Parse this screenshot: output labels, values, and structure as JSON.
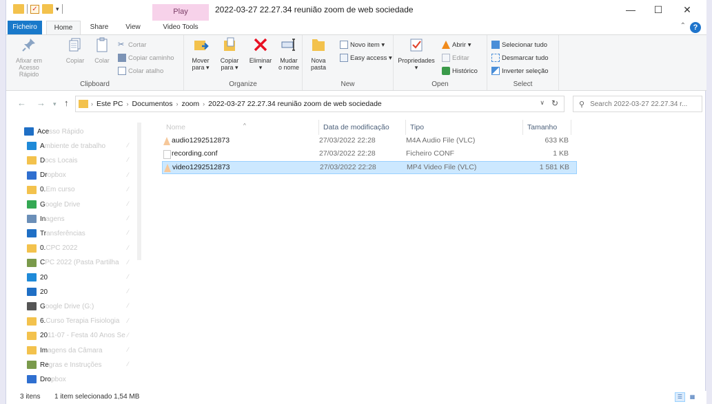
{
  "title_bar": {
    "contextual_tab": "Play",
    "window_title": "2022-03-27 22.27.34 reunião zoom de web sociedade",
    "minimize": "—",
    "maximize": "☐",
    "close": "✕"
  },
  "tabs": [
    "Ficheiro",
    "Home",
    "Share",
    "View",
    "Video Tools"
  ],
  "ribbon": {
    "clipboard": {
      "label": "Clipboard",
      "pin_label": "Afixar em\nAcesso Rápido",
      "copy_label": "Copiar",
      "paste_label": "Colar",
      "cut_label": "Cortar",
      "copy_path_label": "Copiar caminho",
      "paste_shortcut_label": "Colar atalho"
    },
    "organize": {
      "label": "Organize",
      "move_label": "Mover\npara ▾",
      "copy_to_label": "Copiar\npara ▾",
      "delete_label": "Eliminar\n▾",
      "rename_label": "Mudar\no nome"
    },
    "new": {
      "label": "New",
      "new_folder_label": "Nova\npasta",
      "new_item_label": "Novo item ▾",
      "easy_access_label": "Easy access ▾"
    },
    "open": {
      "label": "Open",
      "properties_label": "Propriedades\n▾",
      "open_label": "Abrir ▾",
      "edit_label": "Editar",
      "history_label": "Histórico"
    },
    "select": {
      "label": "Select",
      "select_all_label": "Selecionar tudo",
      "select_none_label": "Desmarcar tudo",
      "invert_label": "Inverter seleção"
    }
  },
  "address": {
    "crumbs": [
      "Este PC",
      "Documentos",
      "zoom",
      "2022-03-27 22.27.34 reunião zoom de web sociedade"
    ],
    "search_placeholder": "Search 2022-03-27 22.27.34 r..."
  },
  "nav_pane": {
    "items": [
      {
        "label": "Ace",
        "faded": "sso Rápido",
        "icon": "star-icon",
        "color": "#1f6fc5"
      },
      {
        "label": "A",
        "faded": "mbiente de trabalho",
        "icon": "desktop-icon",
        "color": "#1f8ad8"
      },
      {
        "label": "D",
        "faded": "ocs Locais",
        "icon": "folder-icon",
        "color": "#f3c24d"
      },
      {
        "label": "Dr",
        "faded": "opbox",
        "icon": "dropbox-icon",
        "color": "#2f6fd0"
      },
      {
        "label": "0.",
        "faded": " Em curso",
        "icon": "folder-icon",
        "color": "#f3c24d"
      },
      {
        "label": "G",
        "faded": "oogle Drive",
        "icon": "google-drive-icon",
        "color": "#34a853"
      },
      {
        "label": "In",
        "faded": "agens",
        "icon": "pictures-icon",
        "color": "#6b8fb8"
      },
      {
        "label": "Tr",
        "faded": "ansferências",
        "icon": "download-icon",
        "color": "#1f6fc5"
      },
      {
        "label": "0.",
        "faded": " CPC 2022",
        "icon": "folder-icon",
        "color": "#f3c24d"
      },
      {
        "label": "C",
        "faded": "PC 2022 (Pasta Partilha",
        "icon": "shared-folder-icon",
        "color": "#7a9a4b"
      },
      {
        "label": "20",
        "faded": "",
        "icon": "globe-icon",
        "color": "#1f8ad8"
      },
      {
        "label": "20",
        "faded": "",
        "icon": "sync-icon",
        "color": "#1f6fc5"
      },
      {
        "label": "G",
        "faded": "oogle Drive (G:)",
        "icon": "drive-icon",
        "color": "#555555"
      },
      {
        "label": "6.",
        "faded": " Curso Terapia Fisiologia",
        "icon": "folder-icon",
        "color": "#f3c24d"
      },
      {
        "label": "20",
        "faded": "11-07 - Festa 40 Anos Se",
        "icon": "folder-icon",
        "color": "#f3c24d"
      },
      {
        "label": "Im",
        "faded": "agens da Câmara",
        "icon": "folder-icon",
        "color": "#f3c24d"
      },
      {
        "label": "Re",
        "faded": "gras e Instruções",
        "icon": "shared-folder-icon",
        "color": "#7a9a4b"
      },
      {
        "label": "Dro",
        "faded": "pbox",
        "icon": "dropbox-icon",
        "color": "#2f6fd0"
      }
    ]
  },
  "file_list": {
    "columns": [
      "Nome",
      "Data de modificação",
      "Tipo",
      "Tamanho"
    ],
    "rows": [
      {
        "name": "audio1292512873",
        "date": "27/03/2022 22:28",
        "type": "M4A Audio File (VLC)",
        "size": "633 KB",
        "selected": false,
        "icon": "vlc-icon"
      },
      {
        "name": "recording.conf",
        "date": "27/03/2022 22:28",
        "type": "Ficheiro CONF",
        "size": "1 KB",
        "selected": false,
        "icon": "file-icon"
      },
      {
        "name": "video1292512873",
        "date": "27/03/2022 22:28",
        "type": "MP4 Video File (VLC)",
        "size": "1 581 KB",
        "selected": true,
        "icon": "vlc-icon"
      }
    ]
  },
  "status_bar": {
    "item_count": "3 itens",
    "selection": "1 item selecionado 1,54 MB"
  }
}
